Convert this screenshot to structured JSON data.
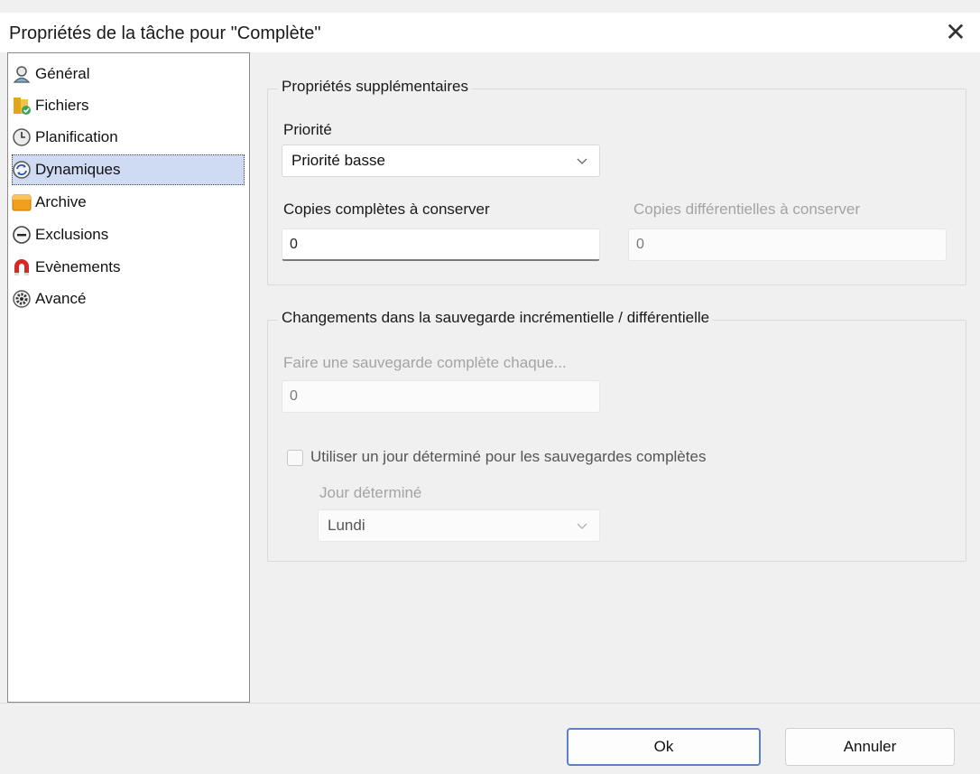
{
  "window": {
    "title": "Propriétés de la tâche pour \"Complète\"",
    "close_glyph": "✕"
  },
  "nav": {
    "items": [
      {
        "label": "Général",
        "icon": "user-icon",
        "selected": false
      },
      {
        "label": "Fichiers",
        "icon": "files-icon",
        "selected": false
      },
      {
        "label": "Planification",
        "icon": "clock-icon",
        "selected": false
      },
      {
        "label": "Dynamiques",
        "icon": "refresh-icon",
        "selected": true
      },
      {
        "label": "Archive",
        "icon": "folder-icon",
        "selected": false
      },
      {
        "label": "Exclusions",
        "icon": "minus-circle-icon",
        "selected": false
      },
      {
        "label": "Evènements",
        "icon": "magnet-icon",
        "selected": false
      },
      {
        "label": "Avancé",
        "icon": "gear-icon",
        "selected": false
      }
    ]
  },
  "props": {
    "group_title": "Propriétés supplémentaires",
    "priority_label": "Priorité",
    "priority_value": "Priorité basse",
    "full_copies_label": "Copies complètes à conserver",
    "full_copies_value": "0",
    "diff_copies_label": "Copies différentielles à conserver",
    "diff_copies_value": "0"
  },
  "changes": {
    "group_title": "Changements dans la sauvegarde incrémentielle / différentielle",
    "full_every_label": "Faire une sauvegarde complète chaque...",
    "full_every_value": "0",
    "use_day_label": "Utiliser un jour déterminé pour les sauvegardes complètes",
    "use_day_checked": false,
    "day_label": "Jour déterminé",
    "day_value": "Lundi"
  },
  "footer": {
    "ok_label": "Ok",
    "cancel_label": "Annuler"
  },
  "colors": {
    "selection_bg": "#cfdaf3",
    "default_button_border": "#5b7fd1",
    "disabled_text": "#a4a4a4"
  }
}
